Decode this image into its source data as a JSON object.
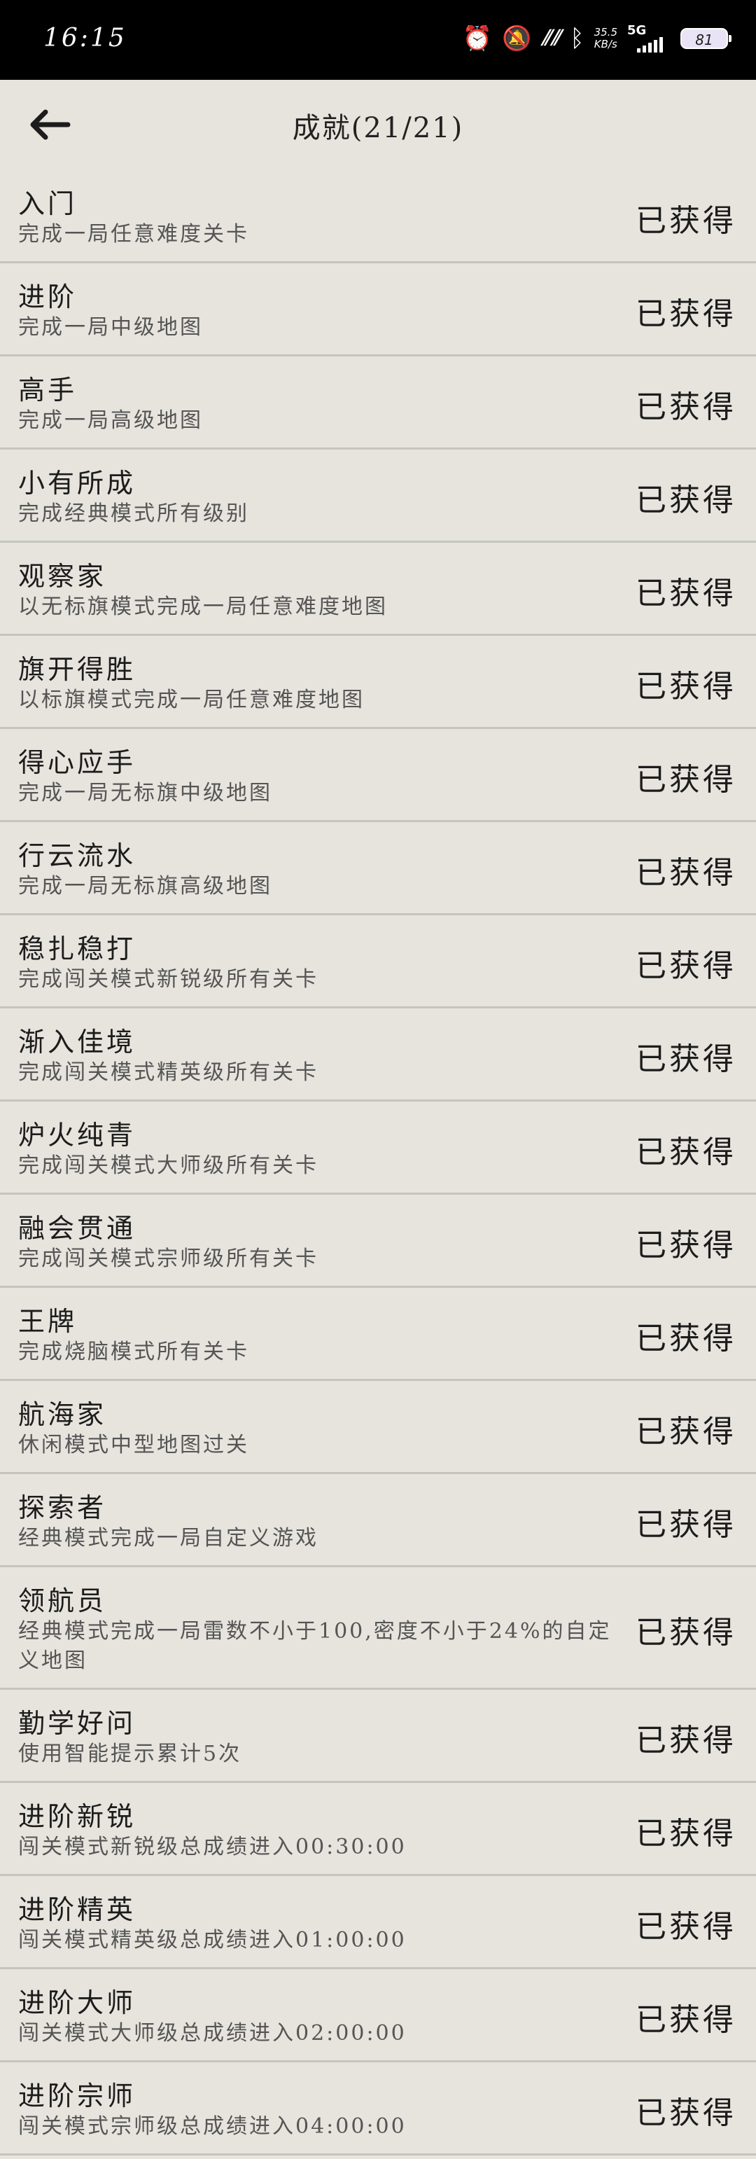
{
  "status_bar": {
    "time": "16:15",
    "net_speed_value": "35.5",
    "net_speed_unit": "KB/s",
    "network": "5G",
    "battery": "81"
  },
  "header": {
    "title": "成就(21/21)"
  },
  "achievements": [
    {
      "name": "入门",
      "desc": "完成一局任意难度关卡",
      "status": "已获得"
    },
    {
      "name": "进阶",
      "desc": "完成一局中级地图",
      "status": "已获得"
    },
    {
      "name": "高手",
      "desc": "完成一局高级地图",
      "status": "已获得"
    },
    {
      "name": "小有所成",
      "desc": "完成经典模式所有级别",
      "status": "已获得"
    },
    {
      "name": "观察家",
      "desc": "以无标旗模式完成一局任意难度地图",
      "status": "已获得"
    },
    {
      "name": "旗开得胜",
      "desc": "以标旗模式完成一局任意难度地图",
      "status": "已获得"
    },
    {
      "name": "得心应手",
      "desc": "完成一局无标旗中级地图",
      "status": "已获得"
    },
    {
      "name": "行云流水",
      "desc": "完成一局无标旗高级地图",
      "status": "已获得"
    },
    {
      "name": "稳扎稳打",
      "desc": "完成闯关模式新锐级所有关卡",
      "status": "已获得"
    },
    {
      "name": "渐入佳境",
      "desc": "完成闯关模式精英级所有关卡",
      "status": "已获得"
    },
    {
      "name": "炉火纯青",
      "desc": "完成闯关模式大师级所有关卡",
      "status": "已获得"
    },
    {
      "name": "融会贯通",
      "desc": "完成闯关模式宗师级所有关卡",
      "status": "已获得"
    },
    {
      "name": "王牌",
      "desc": "完成烧脑模式所有关卡",
      "status": "已获得"
    },
    {
      "name": "航海家",
      "desc": "休闲模式中型地图过关",
      "status": "已获得"
    },
    {
      "name": "探索者",
      "desc": "经典模式完成一局自定义游戏",
      "status": "已获得"
    },
    {
      "name": "领航员",
      "desc": "经典模式完成一局雷数不小于100,密度不小于24%的自定义地图",
      "status": "已获得"
    },
    {
      "name": "勤学好问",
      "desc": "使用智能提示累计5次",
      "status": "已获得"
    },
    {
      "name": "进阶新锐",
      "desc": "闯关模式新锐级总成绩进入00:30:00",
      "status": "已获得"
    },
    {
      "name": "进阶精英",
      "desc": "闯关模式精英级总成绩进入01:00:00",
      "status": "已获得"
    },
    {
      "name": "进阶大师",
      "desc": "闯关模式大师级总成绩进入02:00:00",
      "status": "已获得"
    },
    {
      "name": "进阶宗师",
      "desc": "闯关模式宗师级总成绩进入04:00:00",
      "status": "已获得"
    }
  ]
}
